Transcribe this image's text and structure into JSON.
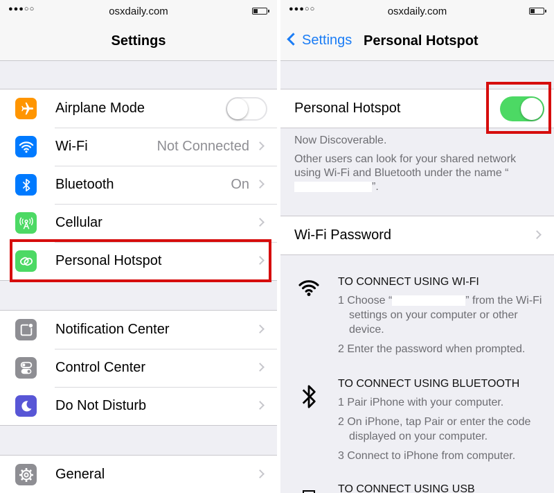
{
  "left": {
    "status": {
      "url": "osxdaily.com"
    },
    "nav": {
      "title": "Settings"
    },
    "group1": [
      {
        "label": "Airplane Mode",
        "value": "",
        "icon": "airplane-icon",
        "color": "#ff9500",
        "accessory": "switch-off"
      },
      {
        "label": "Wi-Fi",
        "value": "Not Connected",
        "icon": "wifi-icon",
        "color": "#007aff",
        "accessory": "chevron"
      },
      {
        "label": "Bluetooth",
        "value": "On",
        "icon": "bluetooth-icon",
        "color": "#007aff",
        "accessory": "chevron"
      },
      {
        "label": "Cellular",
        "value": "",
        "icon": "cellular-antenna-icon",
        "color": "#4cd964",
        "accessory": "chevron"
      },
      {
        "label": "Personal Hotspot",
        "value": "",
        "icon": "hotspot-link-icon",
        "color": "#4cd964",
        "accessory": "chevron"
      }
    ],
    "group2": [
      {
        "label": "Notification Center",
        "icon": "notification-center-icon",
        "color": "#8e8e93"
      },
      {
        "label": "Control Center",
        "icon": "control-center-icon",
        "color": "#8e8e93"
      },
      {
        "label": "Do Not Disturb",
        "icon": "moon-icon",
        "color": "#5856d6"
      }
    ],
    "group3": [
      {
        "label": "General",
        "icon": "gear-icon",
        "color": "#8e8e93"
      }
    ]
  },
  "right": {
    "status": {
      "url": "osxdaily.com"
    },
    "nav": {
      "back": "Settings",
      "title": "Personal Hotspot"
    },
    "hotspot": {
      "label": "Personal Hotspot",
      "state": "on"
    },
    "discoverable": "Now Discoverable.",
    "info_before": "Other users can look for your shared network using Wi-Fi and Bluetooth under the name “",
    "info_after": "”.",
    "wifi_password": "Wi-Fi Password",
    "wifi_section": {
      "heading": "TO CONNECT USING WI-FI",
      "step1_before": "1 Choose “",
      "step1_after": "” from the Wi-Fi settings on your computer or other device.",
      "step2": "2 Enter the password when prompted."
    },
    "bt_section": {
      "heading": "TO CONNECT USING BLUETOOTH",
      "step1": "1 Pair iPhone with your computer.",
      "step2": "2 On iPhone, tap Pair or enter the code displayed on your computer.",
      "step3": "3 Connect to iPhone from computer."
    },
    "usb_section": {
      "heading": "TO CONNECT USING USB"
    }
  },
  "colors": {
    "accent": "#1a7cf5",
    "switch_on": "#4cd964",
    "highlight": "#d60d0d"
  }
}
